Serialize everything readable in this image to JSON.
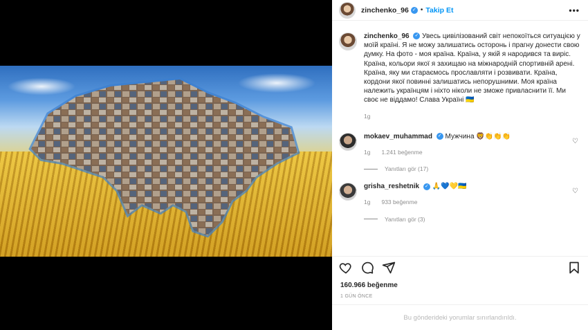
{
  "post": {
    "username": "zinchenko_96",
    "follow_label": "Takip Et",
    "dot_separator": "•",
    "more_icon": "more-horizontal-icon",
    "caption": "Увесь цивілізований світ непокоїться ситуацією у моїй країні. Я не можу залишатись осторонь і прагну донести свою думку. На фото - моя країна. Країна, у якій я народився та виріс. Країна, кольори якої я захищаю на міжнародній спортивній арені. Країна, яку ми стараємось прославляти і розвивати. Країна, кордони якої повинні залишатись непорушними. Моя країна належить українцям і ніхто ніколи не зможе привласнити її. Ми своє не віддамо! Слава Україні 🇺🇦",
    "caption_age": "1g"
  },
  "comments": [
    {
      "username": "mokaev_muhammad",
      "text": "Мужчина 🦁👏👏👏",
      "age": "1g",
      "likes": "1.241 beğenme",
      "replies_label": "Yanıtları gör (17)"
    },
    {
      "username": "grisha_reshetnik",
      "text": "🙏💙💛🇺🇦",
      "age": "1g",
      "likes": "933 beğenme",
      "replies_label": "Yanıtları gör (3)"
    }
  ],
  "footer": {
    "likes_count": "160.966 beğenme",
    "date": "1 GÜN ÖNCE",
    "comments_limited": "Bu gönderideki yorumlar sınırlandırıldı."
  },
  "colors": {
    "accent": "#0095f6",
    "verified": "#3897f0",
    "flag_blue": "#0057b7",
    "flag_yellow": "#ffd700"
  }
}
